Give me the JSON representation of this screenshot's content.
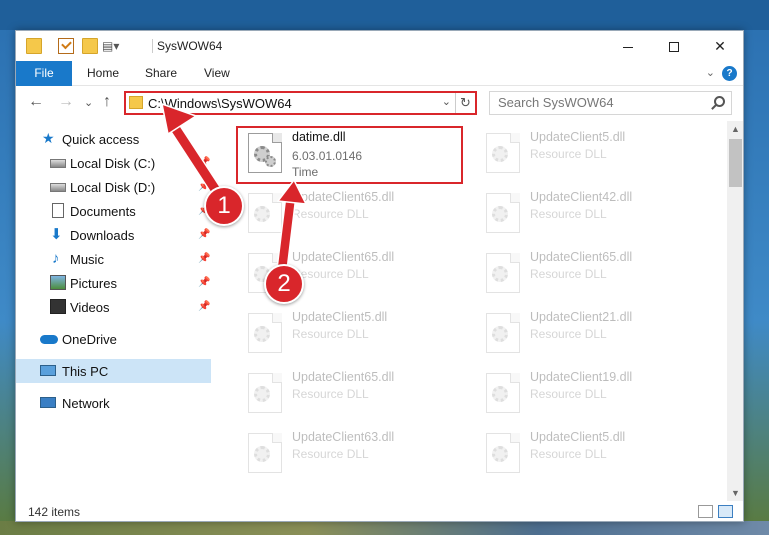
{
  "window": {
    "title": "SysWOW64",
    "controls": {
      "minimize": "",
      "maximize": "",
      "close": "✕"
    }
  },
  "ribbon": {
    "tabs": [
      "File",
      "Home",
      "Share",
      "View"
    ],
    "expand_glyph": "⌄",
    "help_glyph": "?"
  },
  "nav": {
    "back": "←",
    "forward": "→",
    "recent": "⌄",
    "up": "↑",
    "address": "C:\\Windows\\SysWOW64",
    "address_dropdown": "⌄",
    "refresh": "↻",
    "search_placeholder": "Search SysWOW64"
  },
  "sidebar": {
    "items": [
      {
        "label": "Quick access",
        "icon": "star-icon",
        "pinned": false
      },
      {
        "label": "Local Disk (C:)",
        "icon": "drive-icon",
        "pinned": true
      },
      {
        "label": "Local Disk (D:)",
        "icon": "drive-icon",
        "pinned": true
      },
      {
        "label": "Documents",
        "icon": "documents-icon",
        "pinned": true
      },
      {
        "label": "Downloads",
        "icon": "downloads-icon",
        "pinned": true
      },
      {
        "label": "Music",
        "icon": "music-icon",
        "pinned": true
      },
      {
        "label": "Pictures",
        "icon": "pictures-icon",
        "pinned": true
      },
      {
        "label": "Videos",
        "icon": "videos-icon",
        "pinned": true
      },
      {
        "label": "OneDrive",
        "icon": "onedrive-icon",
        "pinned": false
      },
      {
        "label": "This PC",
        "icon": "this-pc-icon",
        "pinned": false,
        "selected": true
      },
      {
        "label": "Network",
        "icon": "network-icon",
        "pinned": false
      }
    ]
  },
  "files": {
    "highlighted": {
      "name": "datime.dll",
      "version": "6.03.01.0146",
      "type": "Time"
    },
    "left_column": [
      {
        "name": "UpdateClient65.dll",
        "type": "Resource DLL"
      },
      {
        "name": "UpdateClient65.dll",
        "type": "Resource DLL"
      },
      {
        "name": "UpdateClient5.dll",
        "type": "Resource DLL"
      },
      {
        "name": "UpdateClient65.dll",
        "type": "Resource DLL"
      },
      {
        "name": "UpdateClient63.dll",
        "type": "Resource DLL"
      }
    ],
    "right_column": [
      {
        "name": "UpdateClient5.dll",
        "type": "Resource DLL"
      },
      {
        "name": "UpdateClient42.dll",
        "type": "Resource DLL"
      },
      {
        "name": "UpdateClient65.dll",
        "type": "Resource DLL"
      },
      {
        "name": "UpdateClient21.dll",
        "type": "Resource DLL"
      },
      {
        "name": "UpdateClient19.dll",
        "type": "Resource DLL"
      },
      {
        "name": "UpdateClient5.dll",
        "type": "Resource DLL"
      }
    ]
  },
  "status": {
    "item_count": "142 items"
  },
  "annotations": {
    "step1": "1",
    "step2": "2",
    "color": "#d9262b"
  },
  "colors": {
    "accent": "#1979ca",
    "selection": "#cce4f7",
    "highlight": "#d9262b"
  }
}
